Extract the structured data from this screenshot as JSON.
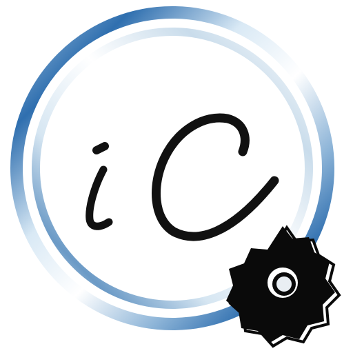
{
  "logo": {
    "monogram": "iC",
    "gear_icon": "gear-icon"
  },
  "colors": {
    "ring_dark_blue": "#1f63a8",
    "ring_mid_blue": "#5f93c3",
    "ring_light_blue": "#bcd6ea",
    "monogram_black": "#111111",
    "gear_black": "#0a0a0a",
    "background": "#ffffff"
  }
}
